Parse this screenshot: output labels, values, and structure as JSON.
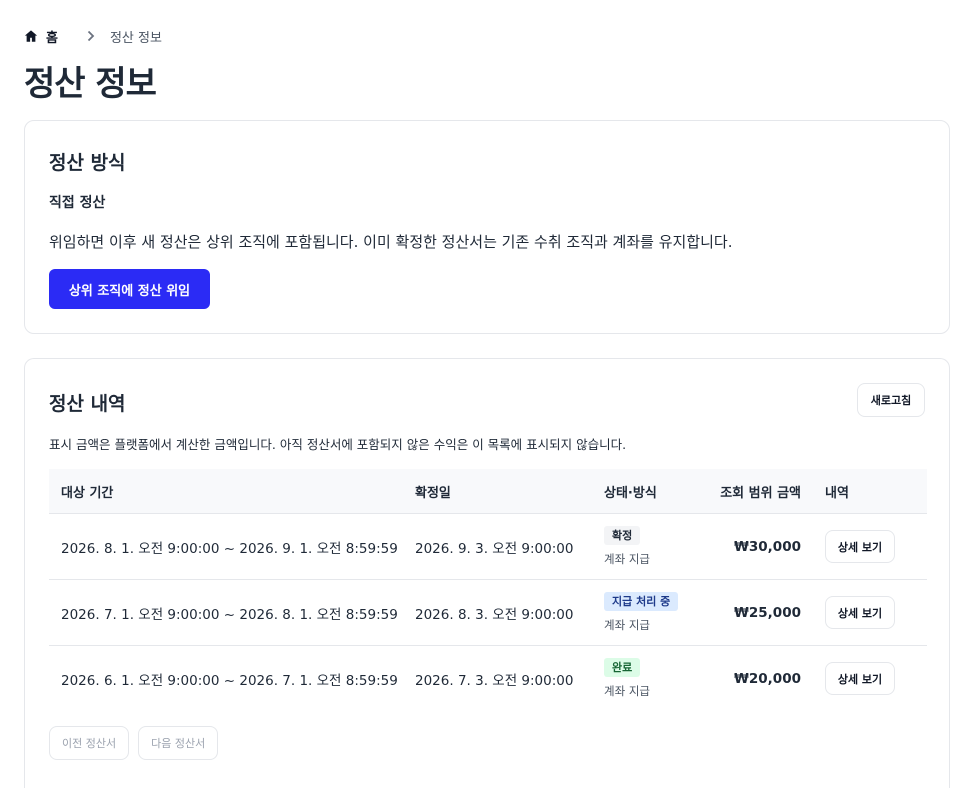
{
  "breadcrumb": {
    "home": "홈",
    "current": "정산 정보"
  },
  "page_title": "정산 정보",
  "settlement_method": {
    "title": "정산 방식",
    "method": "직접 정산",
    "description": "위임하면 이후 새 정산은 상위 조직에 포함됩니다. 이미 확정한 정산서는 기존 수취 조직과 계좌를 유지합니다.",
    "delegate_button": "상위 조직에 정산 위임"
  },
  "history": {
    "title": "정산 내역",
    "refresh_button": "새로고침",
    "note": "표시 금액은 플랫폼에서 계산한 금액입니다. 아직 정산서에 포함되지 않은 수익은 이 목록에 표시되지 않습니다.",
    "columns": [
      "대상 기간",
      "확정일",
      "상태·방식",
      "조회 범위 금액",
      "내역"
    ],
    "rows": [
      {
        "period": "2026. 8. 1. 오전 9:00:00 ~ 2026. 9. 1. 오전 8:59:59",
        "confirmed": "2026. 9. 3. 오전 9:00:00",
        "status": "확정",
        "method": "계좌 지급",
        "amount": "₩30,000",
        "detail": "상세 보기"
      },
      {
        "period": "2026. 7. 1. 오전 9:00:00 ~ 2026. 8. 1. 오전 8:59:59",
        "confirmed": "2026. 8. 3. 오전 9:00:00",
        "status": "지급 처리 중",
        "method": "계좌 지급",
        "amount": "₩25,000",
        "detail": "상세 보기"
      },
      {
        "period": "2026. 6. 1. 오전 9:00:00 ~ 2026. 7. 1. 오전 8:59:59",
        "confirmed": "2026. 7. 3. 오전 9:00:00",
        "status": "완료",
        "method": "계좌 지급",
        "amount": "₩20,000",
        "detail": "상세 보기"
      }
    ],
    "prev_button": "이전 정산서",
    "next_button": "다음 정산서"
  },
  "colors": {
    "primary": "#2b2bf5",
    "processing_bg": "#dbeafe",
    "done_bg": "#dcfce7"
  }
}
